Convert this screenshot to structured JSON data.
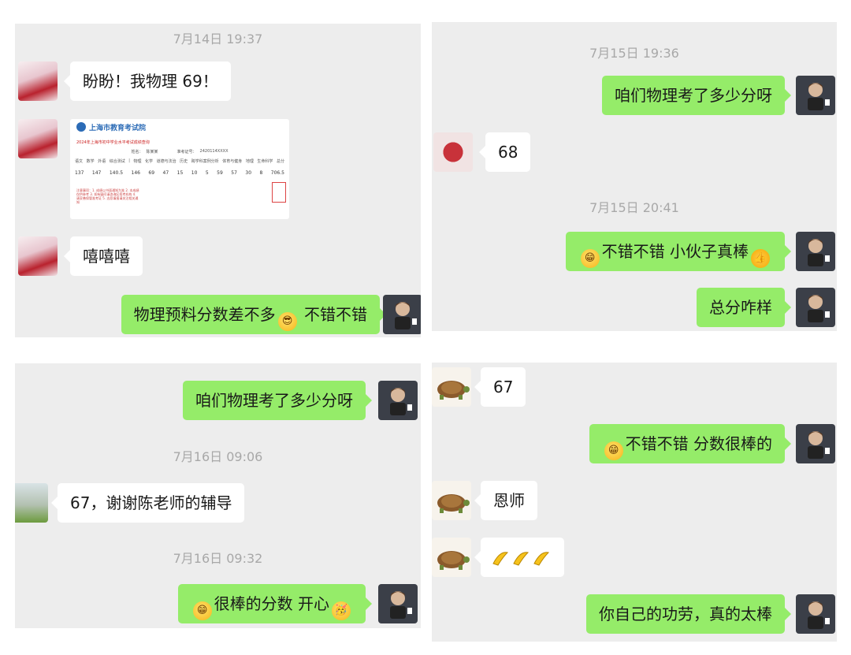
{
  "panels": {
    "top_left": {
      "timestamp": "7月14日 19:37",
      "messages": [
        {
          "side": "in",
          "text": "盼盼！我物理 69！"
        },
        {
          "side": "in",
          "type": "image",
          "image": {
            "org": "上海市教育考试院",
            "title": "2024年上海市初中学业水平考试成绩查询",
            "name_label": "姓名：",
            "name_value": "陈某某",
            "id_label": "准考证号：",
            "id_value": "2420114XXXX",
            "headers": [
              "语文",
              "数学",
              "外语",
              "综合测试",
              "|",
              "物理",
              "化学",
              "道德与法治",
              "历史",
              "跨学科案例分析",
              "体育与健身",
              "地理",
              "生命科学",
              "总分"
            ],
            "scores": [
              "137",
              "147",
              "140.5",
              "146",
              "69",
              "47",
              "15",
              "10",
              "5",
              "59",
              "57",
              "30",
              "8",
              "706.5"
            ],
            "notes": "注意事项：1. 成绩以书面通知为准 2. 本成绩仅供参考 3. 如有疑问请咨询区招考机构 4. 请妥善保管准考证 5. 志愿填报请关注相关通知"
          }
        },
        {
          "side": "in",
          "text": "嘻嘻嘻"
        },
        {
          "side": "out",
          "text_before": "物理预料分数差不多",
          "emoji": "sunglasses-emoji",
          "text_after": " 不错不错"
        }
      ]
    },
    "top_right": {
      "timestamps": [
        "7月15日 19:36",
        "7月15日 20:41"
      ],
      "messages": [
        {
          "side": "out",
          "text": "咱们物理考了多少分呀"
        },
        {
          "side": "in",
          "text": "68"
        },
        {
          "side": "out",
          "emoji": "grin-emoji",
          "text": "不错不错 小伙子真棒",
          "emoji_after": "thumbs-up-emoji"
        },
        {
          "side": "out",
          "text": "总分咋样"
        }
      ]
    },
    "bottom_left": {
      "timestamps": [
        "7月16日 09:06",
        "7月16日 09:32"
      ],
      "messages": [
        {
          "side": "out",
          "text": "咱们物理考了多少分呀"
        },
        {
          "side": "in",
          "text": "67，谢谢陈老师的辅导"
        },
        {
          "side": "out",
          "emoji": "grin-emoji",
          "text": "很棒的分数 开心",
          "emoji_after": "party-emoji"
        }
      ]
    },
    "bottom_right": {
      "messages": [
        {
          "side": "in",
          "text": "67"
        },
        {
          "side": "out",
          "emoji": "grin-emoji",
          "text": "不错不错 分数很棒的"
        },
        {
          "side": "in",
          "text": "恩师"
        },
        {
          "side": "in",
          "emoji_row": "banana-emoji"
        },
        {
          "side": "out",
          "text": "你自己的功劳，真的太棒"
        }
      ]
    }
  },
  "colors": {
    "panel_bg": "#ededed",
    "outgoing_bubble": "#95ec69",
    "incoming_bubble": "#ffffff",
    "timestamp_text": "#a8a8a8"
  }
}
